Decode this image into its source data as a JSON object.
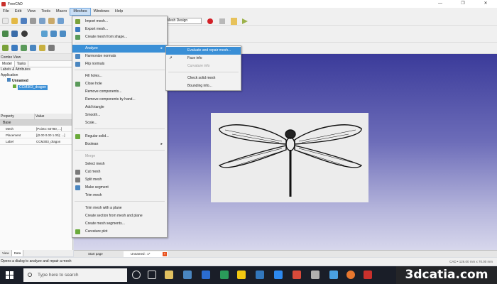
{
  "window": {
    "title": "FreeCAD",
    "controls": [
      "—",
      "❐",
      "✕"
    ]
  },
  "menubar": {
    "items": [
      "File",
      "Edit",
      "View",
      "Tools",
      "Macro",
      "Meshes",
      "Windows",
      "Help"
    ],
    "active": "Meshes"
  },
  "toolbar": {
    "workbench_combo": "Mesh Design"
  },
  "combo_view": {
    "title": "Combo View",
    "tabs": [
      "Model",
      "Tasks"
    ]
  },
  "tree": {
    "labels": "Labels & Attributes",
    "application": "Application",
    "document": "Unnamed",
    "object": "CCM303_dragon"
  },
  "properties": {
    "headers": [
      "Property",
      "Value"
    ],
    "group": "Base",
    "rows": [
      {
        "name": "Mesh",
        "value": "[Points: 60780, ...]"
      },
      {
        "name": "Placement",
        "value": "[(0.00 0.00 1.00); ...]"
      },
      {
        "name": "Label",
        "value": "CCM303_dragon"
      }
    ]
  },
  "panel_tabs": [
    "View",
    "Data"
  ],
  "mesh_menu": {
    "items": [
      {
        "label": "Import mesh...",
        "enabled": true,
        "icon": "import-icon"
      },
      {
        "label": "Export mesh...",
        "enabled": true,
        "icon": "export-icon"
      },
      {
        "label": "Create mesh from shape...",
        "enabled": true,
        "icon": "mesh-from-shape-icon"
      },
      {
        "label": "Analyze",
        "enabled": true,
        "icon": "",
        "submenu": true,
        "highlighted": true
      },
      {
        "label": "Harmonize normals",
        "enabled": true,
        "icon": "harmonize-icon"
      },
      {
        "label": "Flip normals",
        "enabled": true,
        "icon": "flip-icon"
      },
      {
        "label": "Fill holes...",
        "enabled": true,
        "icon": ""
      },
      {
        "label": "Close hole",
        "enabled": true,
        "icon": "close-hole-icon"
      },
      {
        "label": "Remove components...",
        "enabled": true,
        "icon": ""
      },
      {
        "label": "Remove components by hand...",
        "enabled": true,
        "icon": ""
      },
      {
        "label": "Add triangle",
        "enabled": true,
        "icon": ""
      },
      {
        "label": "Smooth...",
        "enabled": true,
        "icon": ""
      },
      {
        "label": "Scale...",
        "enabled": true,
        "icon": ""
      },
      {
        "label": "Regular solid...",
        "enabled": true,
        "icon": "solid-icon"
      },
      {
        "label": "Boolean",
        "enabled": true,
        "icon": "",
        "submenu": true
      },
      {
        "label": "Merge",
        "enabled": false,
        "icon": ""
      },
      {
        "label": "Select mesh",
        "enabled": true,
        "icon": ""
      },
      {
        "label": "Cut mesh",
        "enabled": true,
        "icon": "cut-icon"
      },
      {
        "label": "Split mesh",
        "enabled": true,
        "icon": "split-icon"
      },
      {
        "label": "Make segment",
        "enabled": true,
        "icon": "segment-icon"
      },
      {
        "label": "Trim mesh",
        "enabled": true,
        "icon": ""
      },
      {
        "label": "Trim mesh with a plane",
        "enabled": true,
        "icon": ""
      },
      {
        "label": "Create section from mesh and plane",
        "enabled": true,
        "icon": ""
      },
      {
        "label": "Create mesh segments...",
        "enabled": true,
        "icon": ""
      },
      {
        "label": "Curvature plot",
        "enabled": true,
        "icon": "curvature-icon"
      }
    ]
  },
  "analyze_submenu": {
    "items": [
      {
        "label": "Evaluate and repair mesh...",
        "enabled": true,
        "highlighted": true
      },
      {
        "label": "Face info",
        "enabled": true,
        "icon": "cursor-icon"
      },
      {
        "label": "Curvature info",
        "enabled": false
      },
      {
        "label": "Check solid mesh",
        "enabled": true
      },
      {
        "label": "Bounding info...",
        "enabled": true
      }
    ]
  },
  "document_tabs": {
    "start": "Start page",
    "unnamed": "Unnamed : 1*"
  },
  "status": {
    "text": "Opens a dialog to analyze and repair a mesh",
    "right": "CAD • 126.00 mm x 70.00 mm"
  },
  "taskbar": {
    "search_placeholder": "Type here to search"
  },
  "watermark": "3dcatia.com",
  "colors": {
    "menu_highlight": "#3a8fd6",
    "viewport_top": "#3b3b9a",
    "viewport_bottom": "#d7d7ec",
    "record": "#d22027"
  }
}
